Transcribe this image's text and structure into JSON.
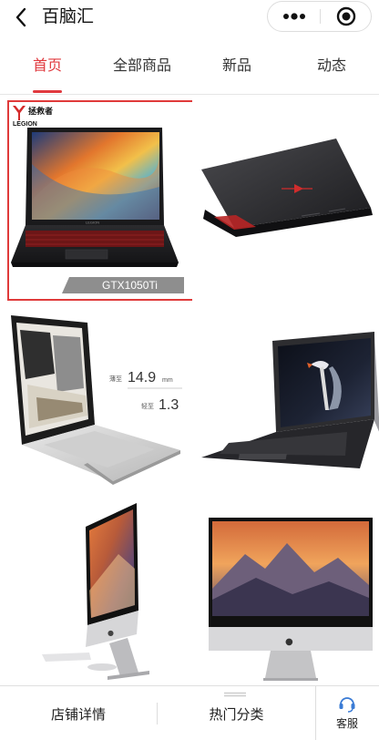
{
  "header": {
    "back_icon": "chevron-left-icon",
    "title": "百脑汇",
    "more_icon": "more-dots-icon",
    "close_icon": "target-circle-icon"
  },
  "tabs": [
    {
      "label": "首页",
      "active": true
    },
    {
      "label": "全部商品",
      "active": false
    },
    {
      "label": "新品",
      "active": false
    },
    {
      "label": "动态",
      "active": false
    }
  ],
  "products": [
    {
      "name": "Lenovo Legion gaming laptop",
      "brand_logo": "拯救者 LEGION",
      "badge": "GTX1050Ti",
      "selected": true
    },
    {
      "name": "Lenovo Legion laptop rear view"
    },
    {
      "name": "HP Envy 13 laptop",
      "spec_thickness": "14.9",
      "spec_thickness_label": "薄至",
      "spec_thickness_unit": "mm",
      "spec_weight": "1.3",
      "spec_weight_label": "轻至"
    },
    {
      "name": "Microsoft Surface Pro"
    },
    {
      "name": "Apple iMac side view"
    },
    {
      "name": "Apple iMac front view"
    }
  ],
  "bottom_bar": {
    "store_details": "店铺详情",
    "hot_categories": "热门分类",
    "customer_service": "客服",
    "service_icon": "headset-icon"
  },
  "colors": {
    "accent": "#e0393e",
    "selected_border": "#e03a3a"
  }
}
